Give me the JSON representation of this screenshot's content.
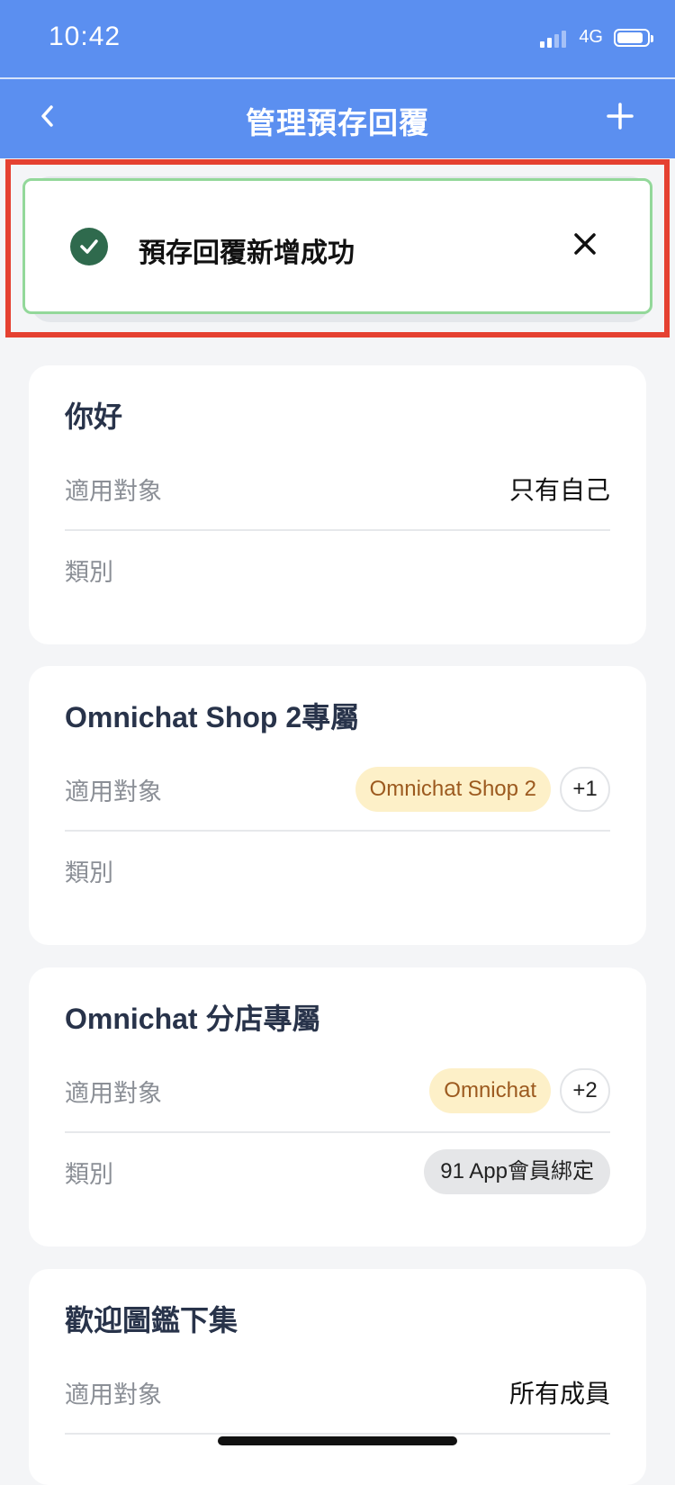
{
  "status_bar": {
    "time": "10:42",
    "network": "4G"
  },
  "nav": {
    "title": "管理預存回覆",
    "back_icon": "chevron-left-icon",
    "add_icon": "plus-icon"
  },
  "toast": {
    "message": "預存回覆新增成功",
    "icon": "check-circle-icon",
    "close_icon": "close-icon",
    "accent": "#93d89a"
  },
  "cards": [
    {
      "title": "你好",
      "audience_label": "適用對象",
      "audience_value": "只有自己",
      "category_label": "類別"
    },
    {
      "title": "Omnichat Shop 2專屬",
      "audience_label": "適用對象",
      "audience_chip": "Omnichat Shop 2",
      "audience_more": "+1",
      "category_label": "類別"
    },
    {
      "title": "Omnichat 分店專屬",
      "audience_label": "適用對象",
      "audience_chip": "Omnichat",
      "audience_more": "+2",
      "category_label": "類別",
      "category_chip": "91 App會員綁定"
    },
    {
      "title": "歡迎圖鑑下集",
      "audience_label": "適用對象",
      "audience_value": "所有成員"
    }
  ],
  "colors": {
    "header": "#5b8ff0",
    "highlight_border": "#e54131",
    "chip_yellow_bg": "#fdf0c8",
    "chip_yellow_text": "#9c5a1f"
  }
}
